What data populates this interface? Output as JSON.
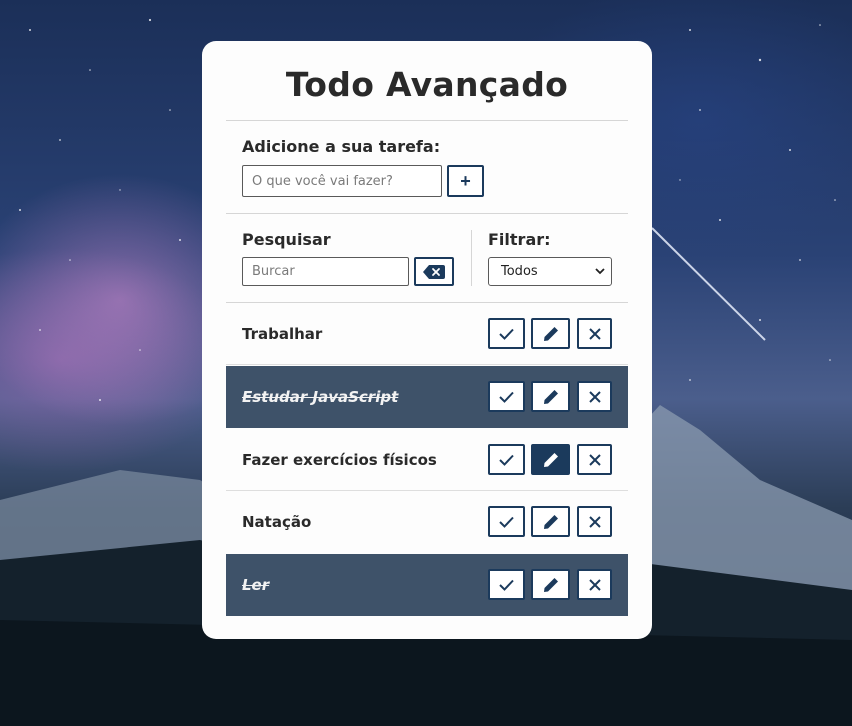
{
  "app": {
    "title": "Todo Avançado"
  },
  "add_section": {
    "label": "Adicione a sua tarefa:",
    "input_placeholder": "O que você vai fazer?",
    "add_button_label": "+"
  },
  "search_section": {
    "label": "Pesquisar",
    "input_placeholder": "Burcar",
    "clear_icon": "backspace-icon"
  },
  "filter_section": {
    "label": "Filtrar:",
    "selected": "Todos"
  },
  "todos": [
    {
      "text": "Trabalhar",
      "done": false
    },
    {
      "text": "Estudar JavaScript",
      "done": true
    },
    {
      "text": "Fazer exercícios físicos",
      "done": false
    },
    {
      "text": "Natação",
      "done": false
    },
    {
      "text": "Ler",
      "done": true
    }
  ],
  "icons": {
    "finish": "check-icon",
    "edit": "pencil-icon",
    "remove": "x-icon"
  },
  "colors": {
    "accent": "#1b3a5c",
    "done_row_bg": "#3e5269",
    "card_bg": "#fdfdfd"
  }
}
